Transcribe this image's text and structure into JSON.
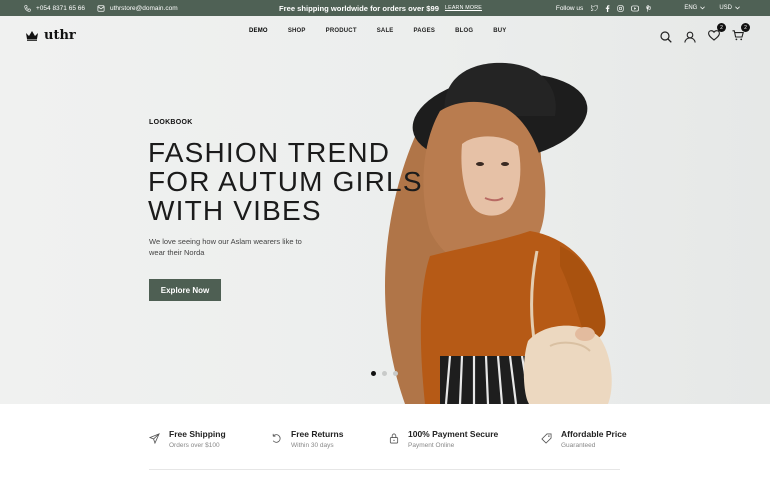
{
  "topbar": {
    "phone": "+054 8371 65 66",
    "email": "uthrstore@domain.com",
    "promo": "Free shipping worldwide for orders over $99",
    "learn_more": "LEARN MORE",
    "follow_us": "Follow us",
    "social_icons": [
      "twitter-icon",
      "facebook-icon",
      "instagram-icon",
      "youtube-icon",
      "pinterest-icon"
    ],
    "language": "ENG",
    "currency": "USD"
  },
  "header": {
    "logo": "uthr",
    "nav": [
      "DEMO",
      "SHOP",
      "PRODUCT",
      "SALE",
      "PAGES",
      "BLOG",
      "BUY"
    ],
    "wishlist_count": "2",
    "cart_count": "2"
  },
  "hero": {
    "eyebrow": "LOOKBOOK",
    "headline": [
      "FASHION TREND",
      "FOR AUTUM GIRLS",
      "WITH VIBES"
    ],
    "subtext": "We love seeing how our Aslam wearers like to wear their Norda",
    "cta": "Explore Now",
    "active_slide": 1,
    "slide_count": 3
  },
  "features": [
    {
      "title": "Free Shipping",
      "subtitle": "Orders over $100",
      "icon": "paper-plane-icon"
    },
    {
      "title": "Free Returns",
      "subtitle": "Within 30 days",
      "icon": "return-icon"
    },
    {
      "title": "100% Payment Secure",
      "subtitle": "Payment Online",
      "icon": "lock-icon"
    },
    {
      "title": "Affordable Price",
      "subtitle": "Guaranteed",
      "icon": "tag-icon"
    }
  ],
  "colors": {
    "topbar_bg": "#4f6155",
    "button_bg": "#4e5f53",
    "hero_bg": "#eef0ef"
  }
}
